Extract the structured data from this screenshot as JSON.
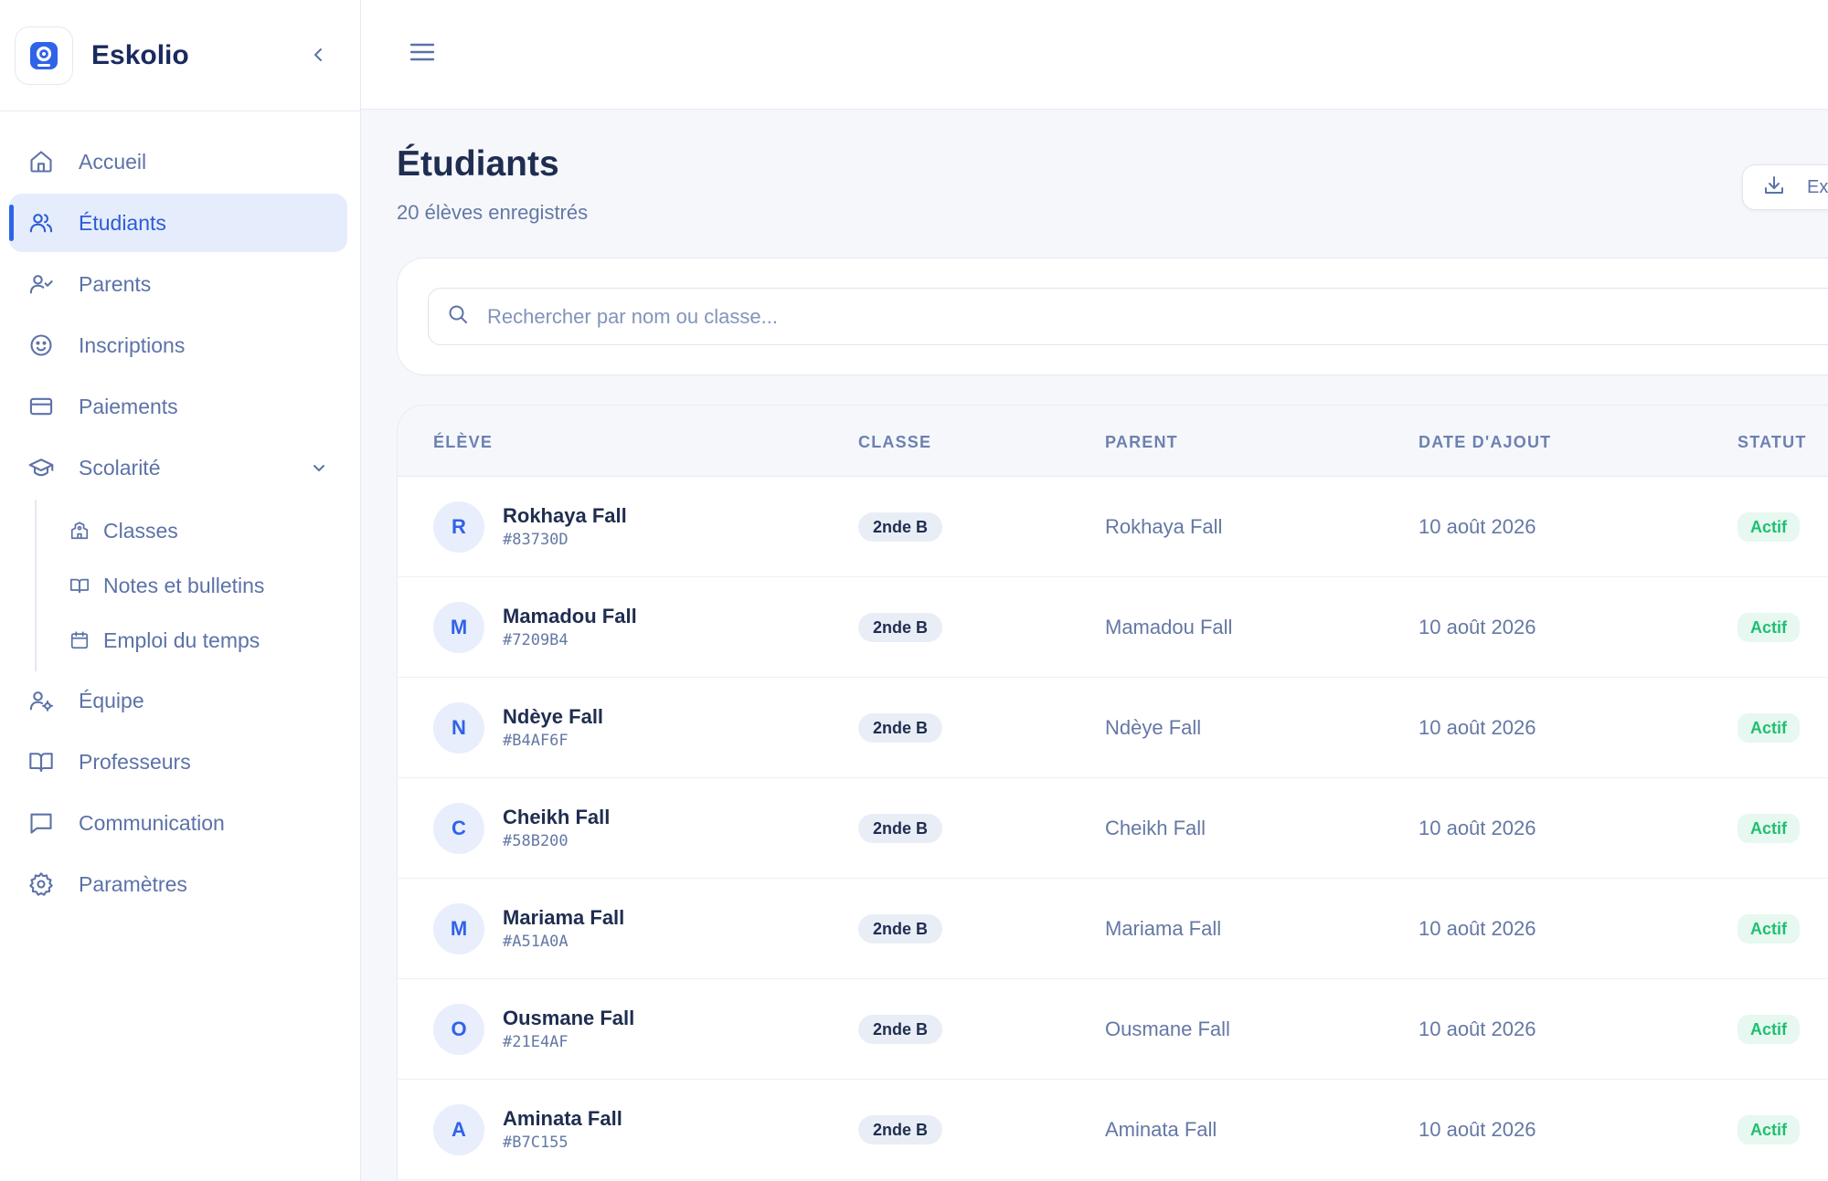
{
  "app": {
    "name": "Eskolio"
  },
  "sidebar": {
    "items": [
      {
        "label": "Accueil"
      },
      {
        "label": "Étudiants"
      },
      {
        "label": "Parents"
      },
      {
        "label": "Inscriptions"
      },
      {
        "label": "Paiements"
      },
      {
        "label": "Scolarité"
      },
      {
        "label": "Équipe"
      },
      {
        "label": "Professeurs"
      },
      {
        "label": "Communication"
      },
      {
        "label": "Paramètres"
      }
    ],
    "sub_items": [
      {
        "label": "Classes"
      },
      {
        "label": "Notes et bulletins"
      },
      {
        "label": "Emploi du temps"
      }
    ]
  },
  "page": {
    "title": "Étudiants",
    "subtitle": "20 élèves enregistrés",
    "export_label": "Ex"
  },
  "search": {
    "placeholder": "Rechercher par nom ou classe..."
  },
  "table": {
    "headers": [
      "ÉLÈVE",
      "CLASSE",
      "PARENT",
      "DATE D'AJOUT",
      "STATUT"
    ],
    "rows": [
      {
        "initial": "R",
        "name": "Rokhaya Fall",
        "id": "#83730D",
        "class": "2nde B",
        "parent": "Rokhaya Fall",
        "date": "10 août 2026",
        "status": "Actif"
      },
      {
        "initial": "M",
        "name": "Mamadou Fall",
        "id": "#7209B4",
        "class": "2nde B",
        "parent": "Mamadou Fall",
        "date": "10 août 2026",
        "status": "Actif"
      },
      {
        "initial": "N",
        "name": "Ndèye Fall",
        "id": "#B4AF6F",
        "class": "2nde B",
        "parent": "Ndèye Fall",
        "date": "10 août 2026",
        "status": "Actif"
      },
      {
        "initial": "C",
        "name": "Cheikh Fall",
        "id": "#58B200",
        "class": "2nde B",
        "parent": "Cheikh Fall",
        "date": "10 août 2026",
        "status": "Actif"
      },
      {
        "initial": "M",
        "name": "Mariama Fall",
        "id": "#A51A0A",
        "class": "2nde B",
        "parent": "Mariama Fall",
        "date": "10 août 2026",
        "status": "Actif"
      },
      {
        "initial": "O",
        "name": "Ousmane Fall",
        "id": "#21E4AF",
        "class": "2nde B",
        "parent": "Ousmane Fall",
        "date": "10 août 2026",
        "status": "Actif"
      },
      {
        "initial": "A",
        "name": "Aminata Fall",
        "id": "#B7C155",
        "class": "2nde B",
        "parent": "Aminata Fall",
        "date": "10 août 2026",
        "status": "Actif"
      }
    ]
  },
  "colors": {
    "accent": "#2f63e8",
    "active_bg": "#e5edfd",
    "status_green": "#1fbf73",
    "status_green_bg": "#e6f8ef",
    "muted_text": "#6478a4"
  },
  "icons": [
    "logo-icon",
    "chevron-left-icon",
    "menu-icon",
    "home-icon",
    "users-icon",
    "user-check-icon",
    "smile-icon",
    "credit-card-icon",
    "graduation-cap-icon",
    "chevron-down-icon",
    "building-icon",
    "book-open-icon",
    "calendar-icon",
    "user-cog-icon",
    "book-icon",
    "message-square-icon",
    "settings-icon",
    "download-icon",
    "search-icon"
  ]
}
